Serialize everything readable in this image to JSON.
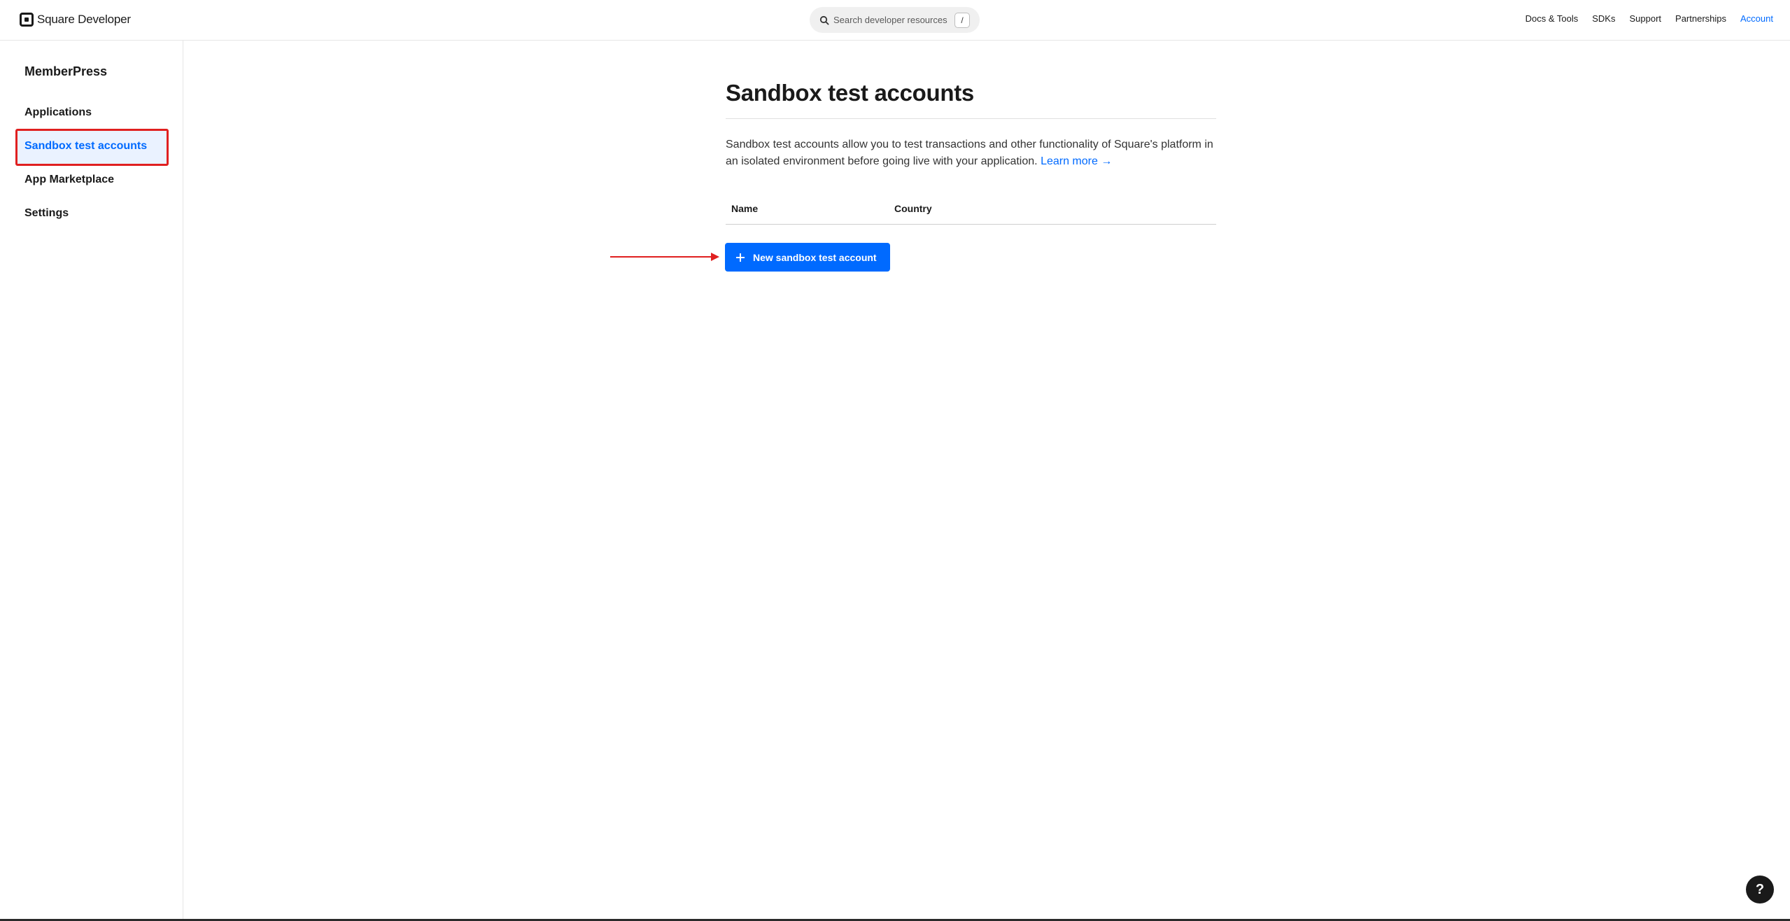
{
  "header": {
    "brand": "Square Developer",
    "search": {
      "placeholder": "Search developer resources",
      "shortcut": "/"
    },
    "nav": [
      {
        "label": "Docs & Tools",
        "active": false
      },
      {
        "label": "SDKs",
        "active": false
      },
      {
        "label": "Support",
        "active": false
      },
      {
        "label": "Partnerships",
        "active": false
      },
      {
        "label": "Account",
        "active": true
      }
    ]
  },
  "sidebar": {
    "org_name": "MemberPress",
    "items": [
      {
        "label": "Applications",
        "active": false
      },
      {
        "label": "Sandbox test accounts",
        "active": true
      },
      {
        "label": "App Marketplace",
        "active": false
      },
      {
        "label": "Settings",
        "active": false
      }
    ]
  },
  "main": {
    "title": "Sandbox test accounts",
    "description": "Sandbox test accounts allow you to test transactions and other functionality of Square's platform in an isolated environment before going live with your application.",
    "learn_more": "Learn more →",
    "table": {
      "columns": [
        "Name",
        "Country"
      ],
      "rows": []
    },
    "new_button": "New sandbox test account"
  },
  "help": {
    "label": "?"
  },
  "colors": {
    "accent": "#006aff",
    "annotation": "#e02020",
    "text": "#1a1a1a"
  },
  "icons": {
    "brand": "square-logo-icon",
    "search": "search-icon",
    "add": "plus-icon",
    "help": "help-icon"
  }
}
